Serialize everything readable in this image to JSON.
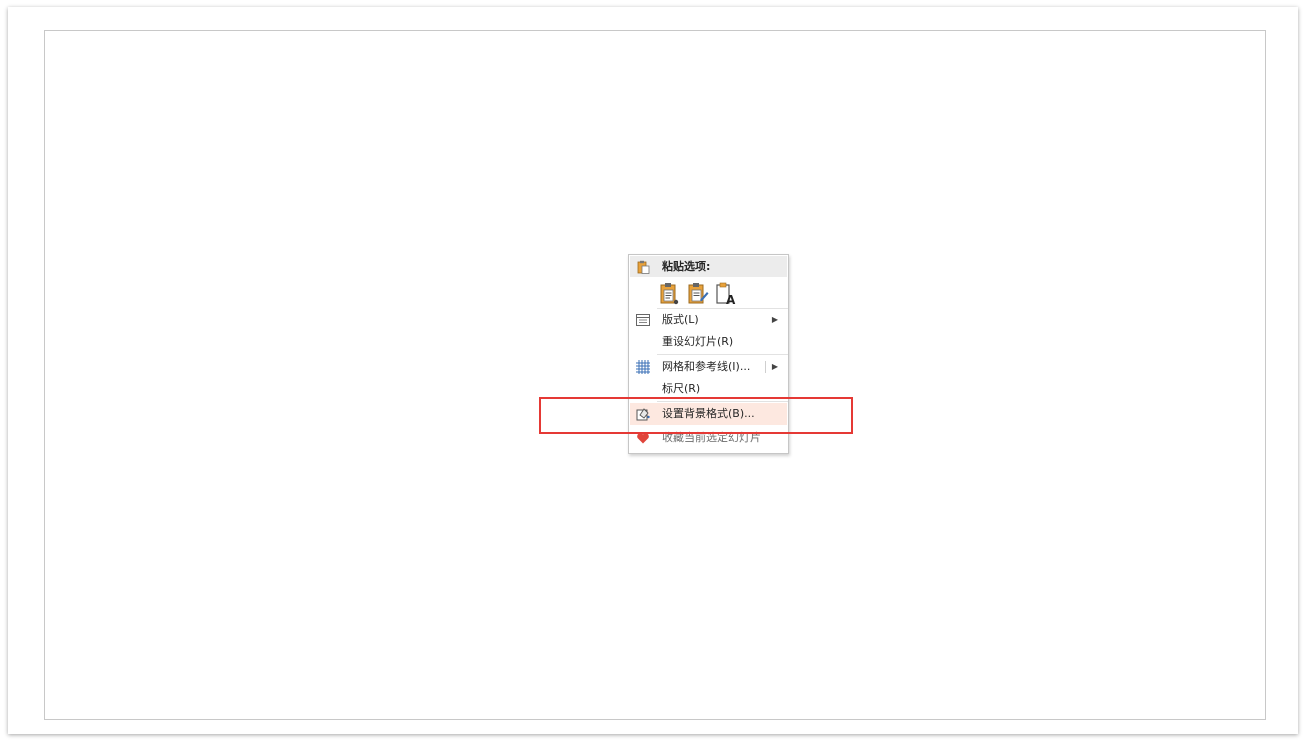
{
  "context_menu": {
    "paste_options_label": "粘贴选项:",
    "paste_icons": [
      "paste-keep-source-icon",
      "paste-picture-icon",
      "paste-text-only-icon"
    ],
    "items": [
      {
        "label": "版式(L)",
        "icon": "layout-icon",
        "submenu": true
      },
      {
        "label": "重设幻灯片(R)",
        "icon": "",
        "submenu": false
      },
      {
        "label": "网格和参考线(I)...",
        "icon": "grid-icon",
        "submenu": true
      },
      {
        "label": "标尺(R)",
        "icon": "",
        "submenu": false
      },
      {
        "label": "设置背景格式(B)...",
        "icon": "format-background-icon",
        "submenu": false,
        "highlighted": true
      },
      {
        "label": "收藏当前选定幻灯片",
        "icon": "heart-icon",
        "submenu": false
      }
    ]
  },
  "colors": {
    "annotation_box": "#e53935",
    "highlight": "#fde8e0",
    "heart": "#e0453b",
    "clipboard": "#e9a23b",
    "grid": "#3a6fb6"
  }
}
